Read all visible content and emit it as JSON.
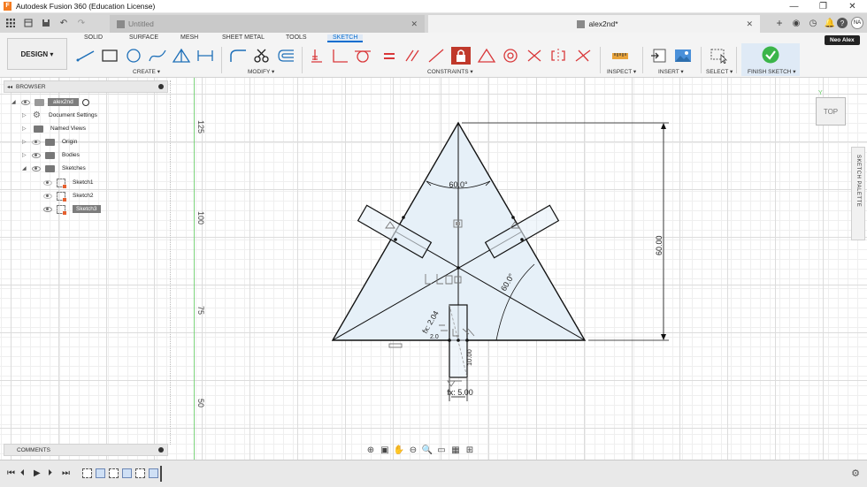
{
  "window": {
    "title": "Autodesk Fusion 360 (Education License)",
    "logo_letter": "F",
    "minimize": "—",
    "maximize": "❐",
    "close": "✕"
  },
  "tabs": {
    "inactive_tab": "Untitled",
    "active_tab": "alex2nd*",
    "user_initials": "NA",
    "help": "?"
  },
  "toolbar": {
    "workspace": "DESIGN ▾",
    "workspace_tabs": [
      "SOLID",
      "SURFACE",
      "MESH",
      "SHEET METAL",
      "TOOLS",
      "SKETCH"
    ],
    "groups": {
      "create": "CREATE ▾",
      "modify": "MODIFY ▾",
      "constraints": "CONSTRAINTS ▾",
      "inspect": "INSPECT ▾",
      "insert": "INSERT ▾",
      "select": "SELECT ▾",
      "finish": "FINISH SKETCH ▾"
    },
    "user_badge": "Neo Alex"
  },
  "browser": {
    "title": "BROWSER",
    "root": "alex2nd",
    "items": [
      {
        "label": "Document Settings"
      },
      {
        "label": "Named Views"
      },
      {
        "label": "Origin"
      },
      {
        "label": "Bodies"
      },
      {
        "label": "Sketches"
      },
      {
        "label": "Sketch1"
      },
      {
        "label": "Sketch2"
      },
      {
        "label": "Sketch3"
      }
    ]
  },
  "comments": {
    "title": "COMMENTS"
  },
  "rulers": [
    "125",
    "100",
    "75",
    "50"
  ],
  "viewcube": {
    "label": "TOP",
    "axis": "Y"
  },
  "palette": {
    "label": "SKETCH PALETTE"
  },
  "dimensions": {
    "angle_top": "60.0°",
    "angle_right": "60.0°",
    "height": "60.00",
    "width_bottom": "fx: 5.00",
    "diag_small": "fx: 2.04",
    "small_vertical": "10.00",
    "small_label": "2.0"
  },
  "colors": {
    "accent": "#0a6ecf",
    "sketch_fill": "#e6f0f8",
    "finish_green": "#3bb54a",
    "lock_red": "#c0392b",
    "constraint_red": "#d9383a"
  }
}
